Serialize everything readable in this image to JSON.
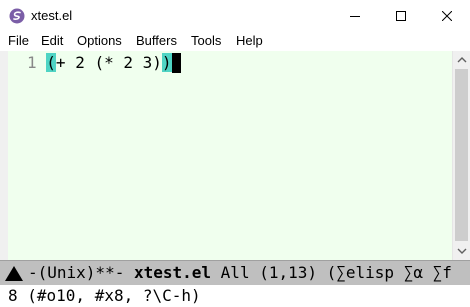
{
  "window": {
    "title": "xtest.el",
    "icon": "emacs-icon"
  },
  "menubar": {
    "items": [
      "File",
      "Edit",
      "Options",
      "Buffers",
      "Tools",
      "Help"
    ]
  },
  "editor": {
    "line_number": "1",
    "open_paren": "(",
    "code_middle": "+ 2 (* 2 3)",
    "close_paren": ")",
    "highlight_color": "#4fd4c4",
    "background_color": "#f0ffee"
  },
  "modeline": {
    "prefix": "-(Unix)**-",
    "buffer_name": "xtest.el",
    "rest": "All (1,13) (∑elisp ∑α ∑f"
  },
  "minibuffer": {
    "text": "8 (#o10, #x8, ?\\C-h)"
  }
}
